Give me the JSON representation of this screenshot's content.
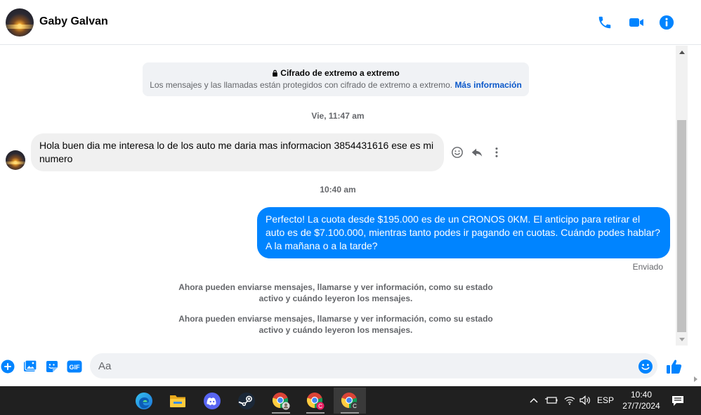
{
  "header": {
    "contact_name": "Gaby Galvan",
    "icons": [
      "phone-icon",
      "video-camera-icon",
      "info-icon"
    ],
    "accent_color": "#0084ff"
  },
  "thread": {
    "e2e": {
      "title": "Cifrado de extremo a extremo",
      "body": "Los mensajes y las llamadas están protegidos con cifrado de extremo a extremo.",
      "link": "Más información"
    },
    "timestamp_1": "Vie, 11:47 am",
    "incoming_message": "Hola buen dia me interesa lo de los auto me daria mas informacion 3854431616 ese es mi numero",
    "timestamp_2": "10:40 am",
    "outgoing_message": "Perfecto! La cuota desde $195.000 es de un CRONOS 0KM. El anticipo para retirar el auto es de $7.100.000, mientras tanto podes ir pagando en cuotas. Cuándo podes hablar? A la mañana o a la tarde?",
    "status": "Enviado",
    "system_message_1": "Ahora pueden enviarse mensajes, llamarse y ver información, como su estado activo y cuándo leyeron los mensajes.",
    "system_message_2": "Ahora pueden enviarse mensajes, llamarse y ver información, como su estado activo y cuándo leyeron los mensajes."
  },
  "composer": {
    "placeholder": "Aa",
    "icons": [
      "plus-icon",
      "image-icon",
      "sticker-icon",
      "gif-icon",
      "emoji-icon",
      "thumbs-up-icon"
    ]
  },
  "taskbar": {
    "language": "ESP",
    "time": "10:40",
    "date": "27/7/2024"
  }
}
